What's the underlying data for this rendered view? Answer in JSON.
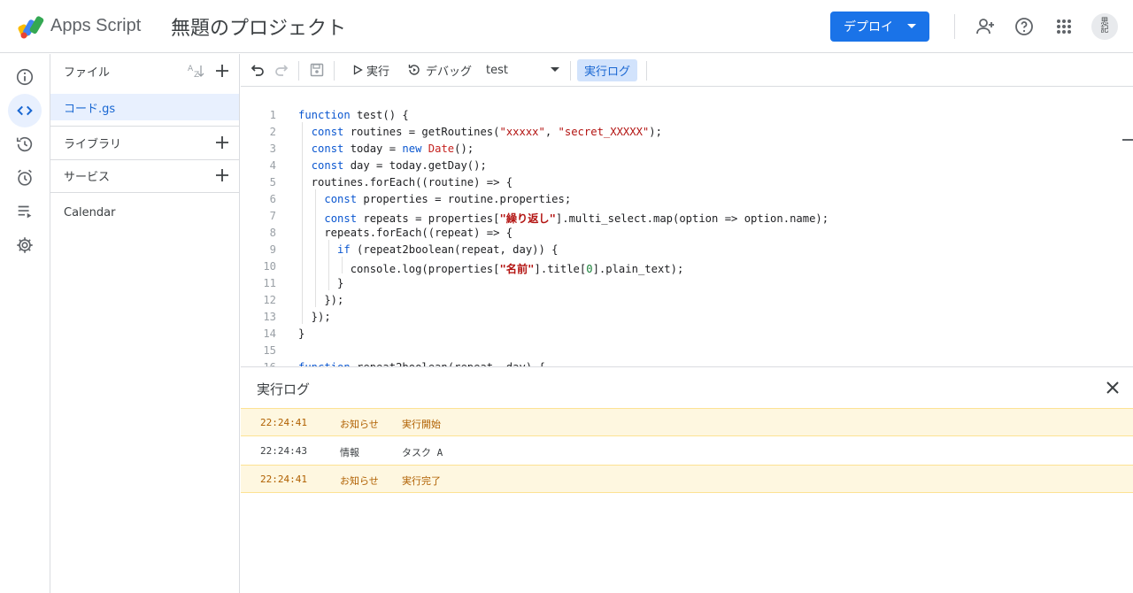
{
  "app": {
    "name": "Apps Script",
    "project_title": "無題のプロジェクト",
    "brand_color": "#1a73e8"
  },
  "header": {
    "deploy_label": "デプロイ",
    "icons": [
      "add-person-icon",
      "help-icon",
      "apps-grid-icon"
    ],
    "avatar_text": "思記"
  },
  "left_rail": {
    "items": [
      "info-icon",
      "code-icon",
      "history-icon",
      "alarm-icon",
      "executions-icon",
      "settings-icon"
    ],
    "active": "code-icon"
  },
  "files_panel": {
    "files_label": "ファイル",
    "file_name": "コード.gs",
    "libraries_label": "ライブラリ",
    "services_label": "サービス",
    "calendar_label": "Calendar"
  },
  "toolbar": {
    "run_label": "実行",
    "debug_label": "デバッグ",
    "function_select": "test",
    "log_button_label": "実行ログ"
  },
  "editor": {
    "line_numbers": [
      "1",
      "2",
      "3",
      "4",
      "5",
      "6",
      "7",
      "8",
      "9",
      "10",
      "11",
      "12",
      "13",
      "14",
      "15",
      "16"
    ]
  },
  "log": {
    "title": "実行ログ",
    "rows": [
      {
        "time": "22:24:41",
        "severity": "お知らせ",
        "message": "実行開始"
      },
      {
        "time": "22:24:43",
        "severity": "情報",
        "message": "タスク A"
      },
      {
        "time": "22:24:41",
        "severity": "お知らせ",
        "message": "実行完了"
      }
    ],
    "notice_color": "#fef7e0"
  }
}
